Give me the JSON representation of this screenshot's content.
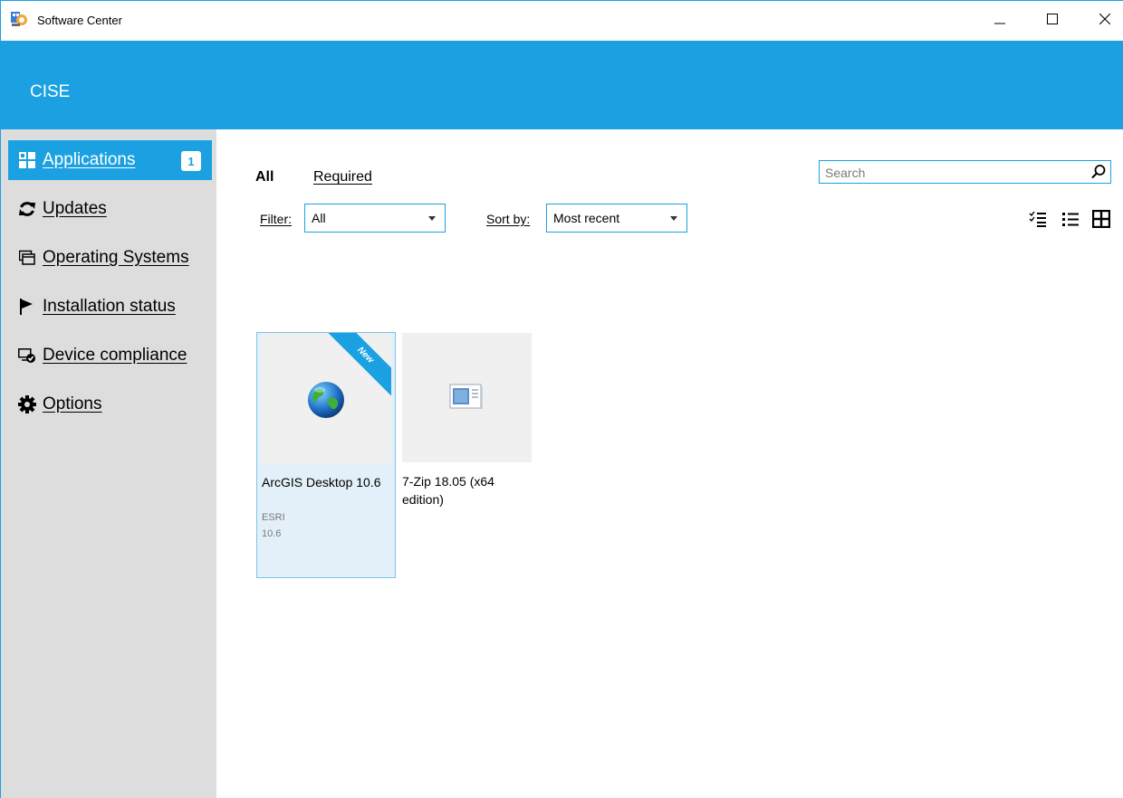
{
  "window": {
    "title": "Software Center",
    "app_icon": "software-center-icon",
    "controls": [
      "minimize-icon",
      "maximize-icon",
      "close-icon"
    ]
  },
  "header": {
    "org_name": "CISE",
    "color": "#1ba1e2"
  },
  "sidebar": {
    "items": [
      {
        "label": "Applications",
        "icon": "apps-grid-icon",
        "badge": "1",
        "active": true
      },
      {
        "label": "Updates",
        "icon": "refresh-icon"
      },
      {
        "label": "Operating Systems",
        "icon": "windows-stack-icon"
      },
      {
        "label": "Installation status",
        "icon": "flag-icon"
      },
      {
        "label": "Device compliance",
        "icon": "device-compliance-icon"
      },
      {
        "label": "Options",
        "icon": "gear-icon"
      }
    ]
  },
  "tabs": {
    "all": "All",
    "required": "Required"
  },
  "search": {
    "placeholder": "Search"
  },
  "filter": {
    "label": "Filter:",
    "value": "All"
  },
  "sort": {
    "label": "Sort by:",
    "value": "Most recent"
  },
  "view_modes": [
    "checklist-view-icon",
    "list-view-icon",
    "tile-view-icon"
  ],
  "apps": [
    {
      "name": "ArcGIS Desktop 10.6",
      "publisher": "ESRI",
      "version": "10.6",
      "badge": "New",
      "icon": "globe-icon",
      "selected": true
    },
    {
      "name": "7-Zip 18.05 (x64 edition)",
      "icon": "generic-app-icon"
    }
  ]
}
